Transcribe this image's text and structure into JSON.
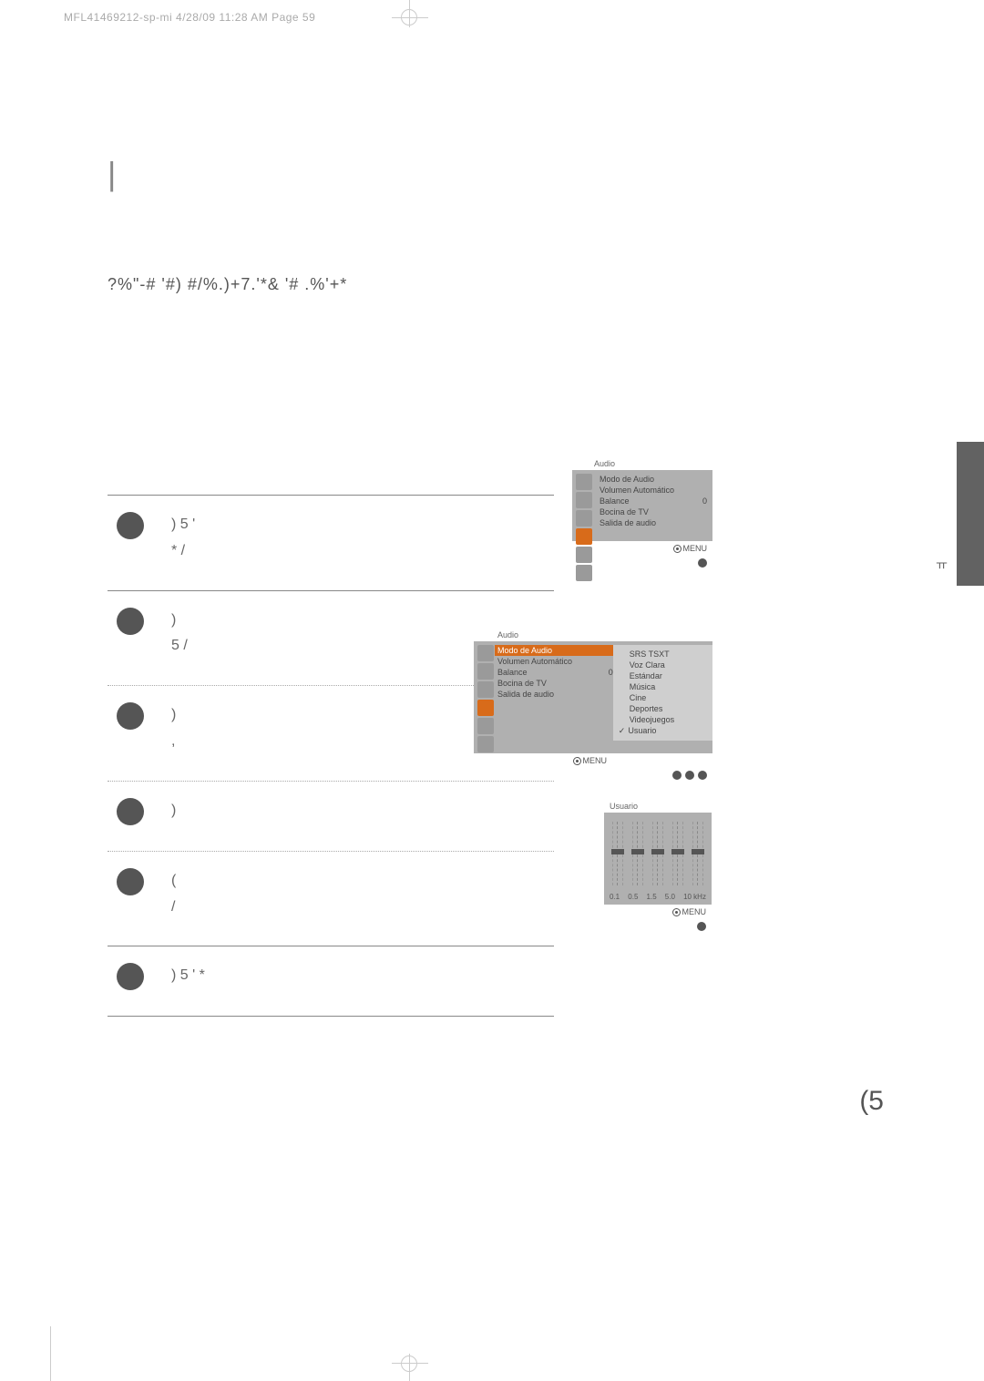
{
  "header": "MFL41469212-sp-mi   4/28/09 11:28 AM  Page 59",
  "big_bar": "|",
  "section_title": "?%\"-# '#) #/%.)+7.'*& '# .%'+*",
  "steps": {
    "s1": ")                    5     '\n                 *        /",
    "s2": ")\n           5          /",
    "s3": ")\n         ,",
    "s4": ")",
    "s5": "(\n/",
    "s6": ")                    5     '                *"
  },
  "osd1": {
    "title": "Audio",
    "items": [
      {
        "label": "Modo de Audio",
        "val": ""
      },
      {
        "label": "Volumen Automático",
        "val": ""
      },
      {
        "label": "Balance",
        "val": "0"
      },
      {
        "label": "Bocina de TV",
        "val": ""
      },
      {
        "label": "Salida de audio",
        "val": ""
      }
    ],
    "menu": "MENU"
  },
  "osd2": {
    "title": "Audio",
    "left": [
      {
        "label": "Modo de Audio",
        "val": "",
        "hl": true
      },
      {
        "label": "Volumen Automático",
        "val": ""
      },
      {
        "label": "Balance",
        "val": "0"
      },
      {
        "label": "Bocina de TV",
        "val": ""
      },
      {
        "label": "Salida de audio",
        "val": ""
      }
    ],
    "right": [
      "SRS TSXT",
      "Voz Clara",
      "Estándar",
      "Música",
      "Cine",
      "Deportes",
      "Videojuegos",
      "Usuario"
    ],
    "menu": "MENU"
  },
  "eq": {
    "title": "Usuario",
    "labels": [
      "0.1",
      "0.5",
      "1.5",
      "5.0",
      "10 kHz"
    ],
    "menu": "MENU"
  },
  "side_char": "ㅠ",
  "page_num": "(5"
}
